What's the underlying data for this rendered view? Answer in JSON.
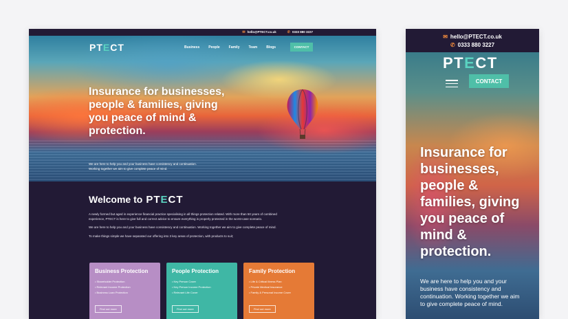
{
  "contact": {
    "email": "hello@PTECT.co.uk",
    "phone": "0333 880 3227"
  },
  "logo": {
    "pre": "PT",
    "e": "E",
    "post": "CT"
  },
  "nav": {
    "items": [
      "Business",
      "People",
      "Family",
      "Team",
      "Blogs"
    ],
    "contact_label": "CONTACT"
  },
  "hero": {
    "title": "Insurance for businesses, people & families, giving you peace of mind & protection.",
    "subtitle_line1": "We are here to help you and your business have consistency and continuation.",
    "subtitle_line2": "Working together we aim to give complete peace of mind."
  },
  "welcome": {
    "title": "Welcome to",
    "para1": "A newly formed but aged in experience financial practice specialising in all things protection related. With more than 50 years of combined experience, PTECT is here to give full and correct advice to ensure everything is properly protected in the worst-case scenario.",
    "para2": "We are here to help you and your business have consistency and continuation. Working together we aim to give complete peace of mind.",
    "para3": "To make things simple we have separated our offering into 3 key areas of protection, with products to suit;"
  },
  "cards": [
    {
      "title": "Business Protection",
      "items": [
        "Shareholder Protection",
        "Relevant Income Protection",
        "Business Loan Protection"
      ],
      "button": "Find out more"
    },
    {
      "title": "People Protection",
      "items": [
        "Key Person Cover",
        "Key Person Income Protection",
        "Relevant Life Cover"
      ],
      "button": "Find out more"
    },
    {
      "title": "Family Protection",
      "items": [
        "Life & Critical Illness Plan",
        "Private Medical Insurance",
        "Family & Personal Income Cover"
      ],
      "button": "Find out more"
    }
  ],
  "mobile": {
    "title": "Insurance for businesses, people & families, giving you peace of mind &  protection.",
    "subtitle": "We are here to help you and your business have consistency and continuation. Working together we aim to give complete peace of mind."
  }
}
